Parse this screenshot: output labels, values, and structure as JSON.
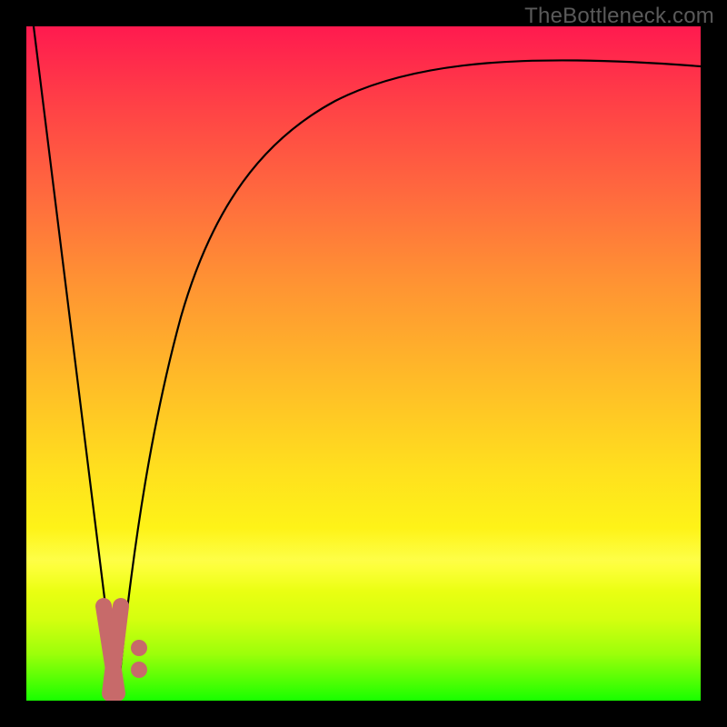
{
  "watermark": "TheBottleneck.com",
  "chart_data": {
    "type": "line",
    "title": "",
    "xlabel": "",
    "ylabel": "",
    "xlim": [
      0,
      100
    ],
    "ylim": [
      0,
      100
    ],
    "series": [
      {
        "name": "left-falling-segment",
        "x": [
          0,
          13
        ],
        "y": [
          100,
          0
        ]
      },
      {
        "name": "right-recovery-curve",
        "x": [
          13,
          16,
          20,
          26,
          34,
          44,
          58,
          76,
          100
        ],
        "y": [
          0,
          22,
          42,
          58,
          70,
          79,
          86,
          91,
          94
        ]
      }
    ],
    "markers": {
      "name": "bottleneck-cluster",
      "color": "#c76a6a",
      "v_segment": {
        "x": 12.5,
        "y0": 2,
        "y1": 14
      },
      "dots": [
        {
          "x": 16.5,
          "y": 7.5
        },
        {
          "x": 16.5,
          "y": 4.3
        }
      ]
    },
    "background": {
      "gradient_stops": [
        {
          "pos": 0.0,
          "color": "#ff1a4f"
        },
        {
          "pos": 0.25,
          "color": "#ff6a3e"
        },
        {
          "pos": 0.52,
          "color": "#ffba28"
        },
        {
          "pos": 0.8,
          "color": "#fdff14"
        },
        {
          "pos": 1.0,
          "color": "#18ff00"
        }
      ]
    }
  }
}
